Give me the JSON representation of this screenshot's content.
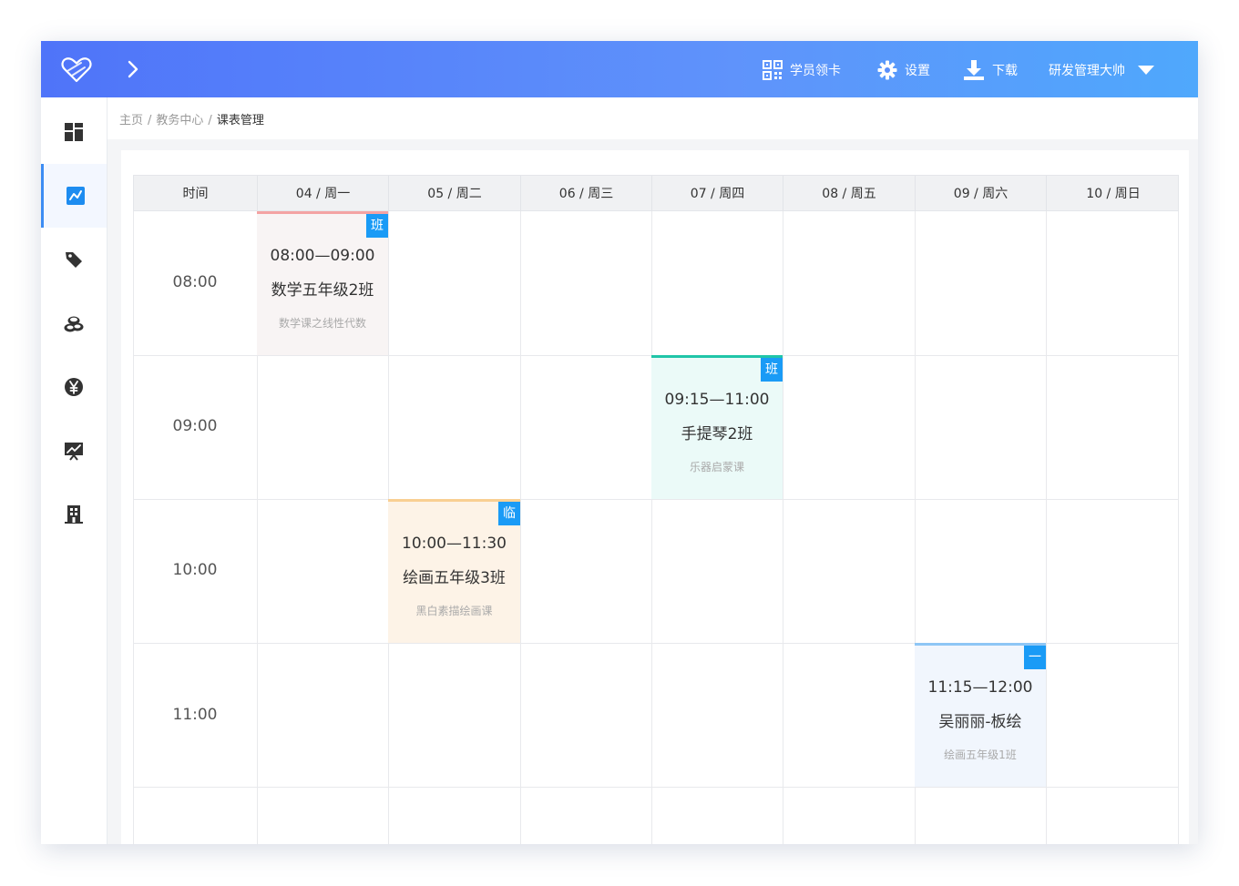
{
  "header": {
    "nav": [
      {
        "label": "学员领卡",
        "icon": "qrcode-icon"
      },
      {
        "label": "设置",
        "icon": "gear-icon"
      },
      {
        "label": "下载",
        "icon": "download-icon"
      }
    ],
    "user": "研发管理大帅"
  },
  "sidebar": {
    "items": [
      {
        "icon": "dashboard-icon",
        "active": false
      },
      {
        "icon": "schedule-icon",
        "active": true
      },
      {
        "icon": "tag-icon",
        "active": false
      },
      {
        "icon": "coins-icon",
        "active": false
      },
      {
        "icon": "yen-icon",
        "active": false
      },
      {
        "icon": "chart-icon",
        "active": false
      },
      {
        "icon": "building-icon",
        "active": false
      }
    ]
  },
  "breadcrumb": [
    "主页",
    "教务中心",
    "课表管理"
  ],
  "schedule": {
    "columns": [
      "时间",
      "04 / 周一",
      "05 / 周二",
      "06 / 周三",
      "07 / 周四",
      "08 / 周五",
      "09 / 周六",
      "10 / 周日"
    ],
    "times": [
      "08:00",
      "09:00",
      "10:00",
      "11:00"
    ],
    "events": [
      {
        "day": 1,
        "hour": 0,
        "time": "08:00—09:00",
        "title": "数学五年级2班",
        "subtitle": "数学课之线性代数",
        "tag": "班",
        "accent": "#f4a3a3",
        "bg": "#f8f4f4"
      },
      {
        "day": 4,
        "hour": 1,
        "time": "09:15—11:00",
        "title": "手提琴2班",
        "subtitle": "乐器启蒙课",
        "tag": "班",
        "accent": "#20c5a8",
        "bg": "#ebfaf8"
      },
      {
        "day": 2,
        "hour": 2,
        "time": "10:00—11:30",
        "title": "绘画五年级3班",
        "subtitle": "黑白素描绘画课",
        "tag": "临",
        "accent": "#f9cf92",
        "bg": "#fdf3e7"
      },
      {
        "day": 6,
        "hour": 3,
        "time": "11:15—12:00",
        "title": "吴丽丽-板绘",
        "subtitle": "绘画五年级1班",
        "tag": "一",
        "accent": "#8ec6f5",
        "bg": "#f1f6fd"
      }
    ]
  }
}
